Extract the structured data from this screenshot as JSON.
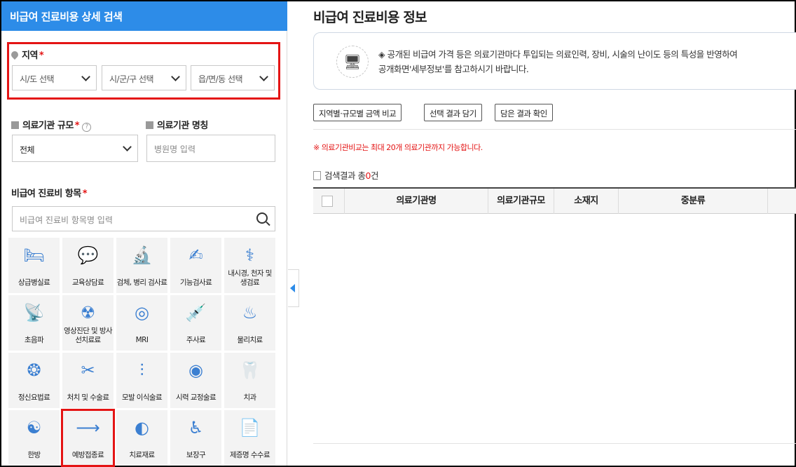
{
  "left_panel": {
    "header": "비급여 진료비용 상세 검색",
    "region": {
      "label": "지역",
      "required_mark": "*",
      "sido_placeholder": "시/도 선택",
      "sigungu_placeholder": "시/군/구 선택",
      "eupmyeondong_placeholder": "읍/면/동 선택"
    },
    "scale": {
      "label": "의료기관 규모",
      "required_mark": "*",
      "help": "?",
      "value": "전체"
    },
    "name": {
      "label": "의료기관 명칭",
      "placeholder": "병원명 입력"
    },
    "items": {
      "label": "비급여 진료비 항목",
      "required_mark": "*",
      "search_placeholder": "비급여 진료비 항목명 입력"
    },
    "categories": [
      {
        "name": "상급병실료",
        "icon": "hospital-bed-icon"
      },
      {
        "name": "교육상담료",
        "icon": "counseling-icon"
      },
      {
        "name": "검체, 병리 검사료",
        "icon": "specimen-test-icon"
      },
      {
        "name": "기능검사료",
        "icon": "function-test-icon"
      },
      {
        "name": "내시경, 천자 및 생검료",
        "icon": "endoscope-icon"
      },
      {
        "name": "초음파",
        "icon": "ultrasound-icon"
      },
      {
        "name": "영상진단 및 방사선치료료",
        "icon": "radiology-icon"
      },
      {
        "name": "MRI",
        "icon": "mri-icon"
      },
      {
        "name": "주사료",
        "icon": "syringe-icon"
      },
      {
        "name": "물리치료",
        "icon": "physical-therapy-icon"
      },
      {
        "name": "정신요법료",
        "icon": "psychotherapy-icon"
      },
      {
        "name": "처치 및 수술료",
        "icon": "surgery-icon"
      },
      {
        "name": "모발 이식술료",
        "icon": "hair-transplant-icon"
      },
      {
        "name": "시력 교정술료",
        "icon": "vision-correction-icon"
      },
      {
        "name": "치과",
        "icon": "tooth-icon"
      },
      {
        "name": "한방",
        "icon": "oriental-medicine-icon"
      },
      {
        "name": "예방접종료",
        "icon": "vaccination-icon"
      },
      {
        "name": "치료재료",
        "icon": "treatment-material-icon"
      },
      {
        "name": "보장구",
        "icon": "wheelchair-icon"
      },
      {
        "name": "제증명 수수료",
        "icon": "certificate-icon"
      }
    ]
  },
  "right_panel": {
    "title": "비급여 진료비용 정보",
    "info_line1": "◈ 공개된 비급여 가격 등은 의료기관마다 투입되는 의료인력, 장비, 시술의 난이도 등의 특성을 반영하여",
    "info_line2": "공개화면'세부정보'를 참고하시기 바랍니다.",
    "buttons": {
      "compare": "지역별·규모별 금액 비교",
      "save_selection": "선택 결과 담기",
      "view_saved": "담은 결과 확인"
    },
    "notice": "※ 의료기관비교는 최대 20개 의료기관까지 가능합니다.",
    "result": {
      "prefix": "검색결과 총",
      "count": "0",
      "suffix": "건"
    },
    "table_headers": {
      "name": "의료기관명",
      "scale": "의료기관규모",
      "location": "소재지",
      "category": "중분류"
    }
  },
  "colors": {
    "accent": "#2d8ce8",
    "highlight": "#e41414",
    "icon": "#3b7fd1"
  }
}
